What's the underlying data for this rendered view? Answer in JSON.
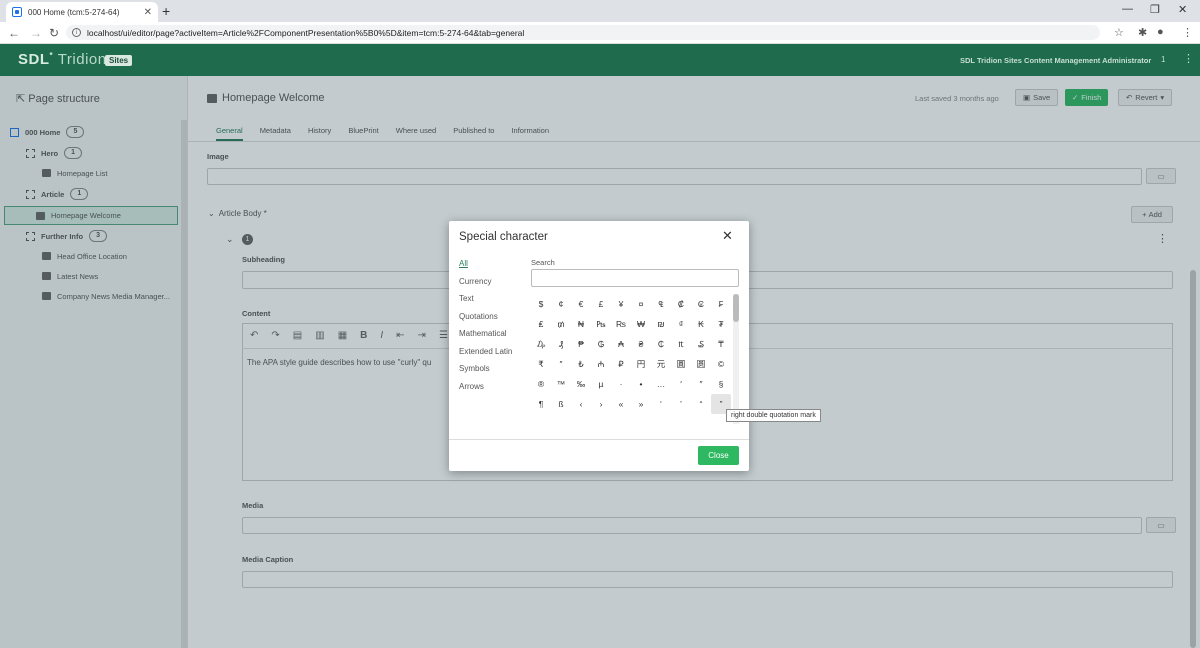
{
  "browser": {
    "tab_title": "000 Home (tcm:5-274-64)",
    "url": "localhost/ui/editor/page?activeItem=Article%2FComponentPresentation%5B0%5D&item=tcm:5-274-64&tab=general"
  },
  "app": {
    "logo_bold": "SDL",
    "logo_light": "Tridion",
    "sites_badge": "Sites",
    "user": "SDL Tridion Sites Content Management Administrator",
    "notifications": "1"
  },
  "page_structure": {
    "title": "Page structure",
    "items": [
      {
        "label": "000 Home",
        "count": "5"
      },
      {
        "label": "Hero",
        "count": "1"
      },
      {
        "label": "Homepage List"
      },
      {
        "label": "Article",
        "count": "1"
      },
      {
        "label": "Homepage Welcome"
      },
      {
        "label": "Further Info",
        "count": "3"
      },
      {
        "label": "Head Office Location"
      },
      {
        "label": "Latest News"
      },
      {
        "label": "Company News Media Manager..."
      }
    ]
  },
  "editor": {
    "title": "Homepage Welcome",
    "last_saved": "Last saved 3 months ago",
    "save": "Save",
    "finish": "Finish",
    "revert": "Revert",
    "tabs": [
      "General",
      "Metadata",
      "History",
      "BluePrint",
      "Where used",
      "Published to",
      "Information"
    ],
    "image_label": "Image",
    "article_body_label": "Article Body *",
    "add": "Add",
    "item_number": "1",
    "subheading_label": "Subheading",
    "content_label": "Content",
    "content_text": "The APA style guide describes how to use \"curly\" qu",
    "media_label": "Media",
    "media_caption_label": "Media Caption"
  },
  "dialog": {
    "title": "Special character",
    "categories": [
      "All",
      "Currency",
      "Text",
      "Quotations",
      "Mathematical",
      "Extended Latin",
      "Symbols",
      "Arrows"
    ],
    "search_label": "Search",
    "search_value": "",
    "chars": [
      [
        "$",
        "¢",
        "€",
        "£",
        "¥",
        "¤",
        "₠",
        "₡",
        "₢",
        "₣"
      ],
      [
        "₤",
        "₥",
        "₦",
        "₧",
        "₨",
        "₩",
        "₪",
        "₫",
        "₭",
        "₮"
      ],
      [
        "₯",
        "₰",
        "₱",
        "₲",
        "₳",
        "₴",
        "₵",
        "₶",
        "₷",
        "₸"
      ],
      [
        "₹",
        "″",
        "₺",
        "₼",
        "₽",
        "円",
        "元",
        "圓",
        "圆",
        "©"
      ],
      [
        "®",
        "™",
        "‰",
        "µ",
        "·",
        "•",
        "…",
        "′",
        "″",
        "§"
      ],
      [
        "¶",
        "ß",
        "‹",
        "›",
        "«",
        "»",
        "‘",
        "’",
        "“",
        "”"
      ]
    ],
    "highlighted": "right double quotation mark",
    "close": "Close",
    "accent": "#2eb861"
  }
}
